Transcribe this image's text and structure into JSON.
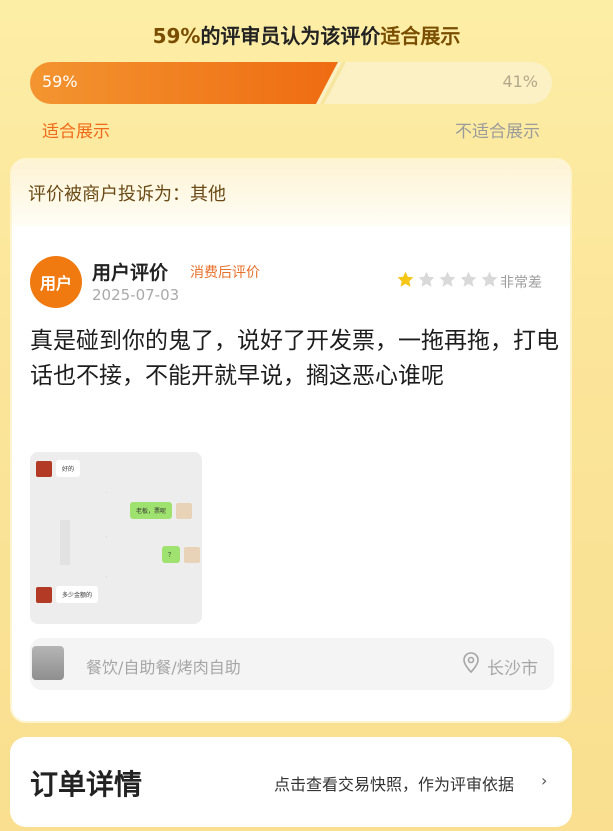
{
  "summary": {
    "headline_pct": "59%",
    "headline_mid": "的评审员认为该评价",
    "headline_tag": "适合展示",
    "bar_left": "59%",
    "bar_right": "41%",
    "suitable_fraction": 0.59,
    "caption_left": "适合展示",
    "caption_right": "不适合展示"
  },
  "review": {
    "complaint": "评价被商户投诉为：其他",
    "avatar_text": "用户",
    "user_label": "用户评价",
    "user_tag": "消费后评价",
    "date": "2025-07-03",
    "stars_filled": 1,
    "stars_total": 5,
    "rating_text": "非常差",
    "body": "真是碰到你的鬼了，说好了开发票，一拖再拖，打电话也不接，不能开就早说，搁这恶心谁呢",
    "thumb": {
      "msg1": "好的",
      "msg2": "老板，票呢",
      "msg3": "？",
      "msg4": "多少金额的"
    },
    "category": "餐饮/自助餐/烤肉自助",
    "city": "长沙市"
  },
  "order": {
    "title": "订单详情",
    "link": "点击查看交易快照，作为评审依据",
    "chevron": "›"
  },
  "colors": {
    "accent": "#ef6b12",
    "star_filled": "#f5c518",
    "star_empty": "#d9d9d9"
  }
}
